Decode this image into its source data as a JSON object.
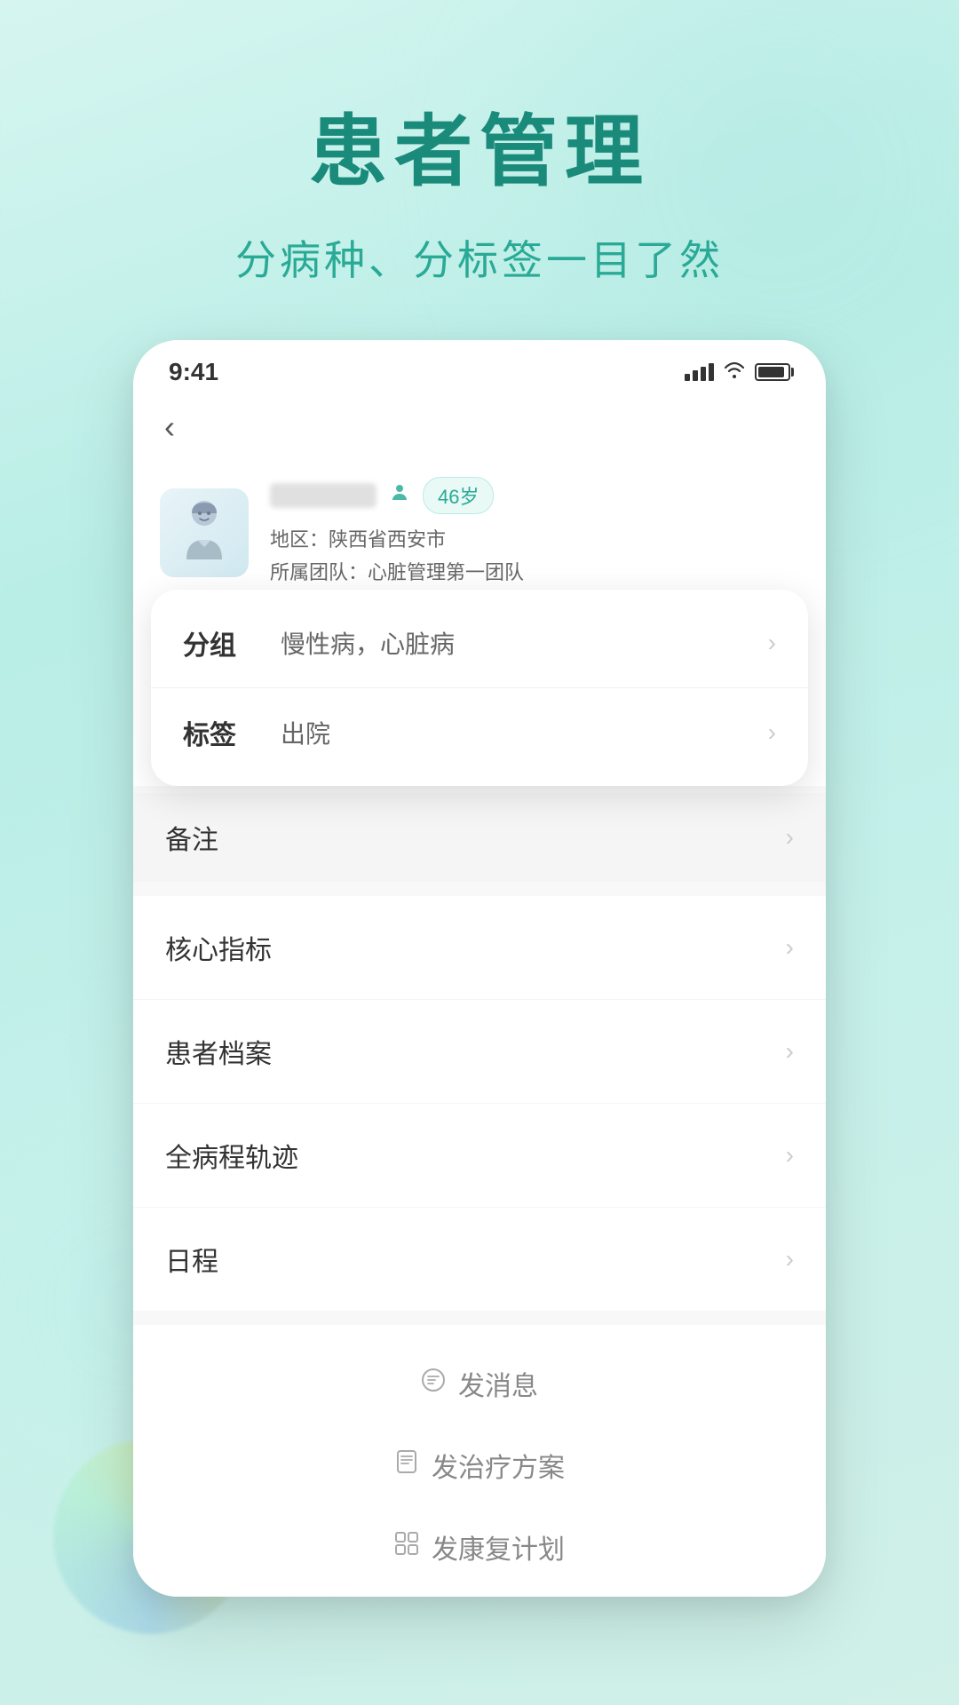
{
  "background": {
    "gradient_start": "#d6f5f0",
    "gradient_end": "#d0f0e8"
  },
  "header": {
    "main_title": "患者管理",
    "sub_title": "分病种、分标签一目了然"
  },
  "status_bar": {
    "time": "9:41",
    "alt": "status icons"
  },
  "nav": {
    "back_label": "‹"
  },
  "patient": {
    "name_placeholder": "患者姓名",
    "age_badge": "46岁",
    "region_label": "地区：",
    "region_value": "陕西省西安市",
    "team_label": "所属团队：",
    "team_value": "心脏管理第一团队"
  },
  "overlay_card": {
    "group": {
      "label": "分组",
      "value": "慢性病，心脏病"
    },
    "tag": {
      "label": "标签",
      "value": "出院"
    }
  },
  "menu_items": [
    {
      "label": "备注",
      "id": "notes"
    },
    {
      "label": "核心指标",
      "id": "core-indicators"
    },
    {
      "label": "患者档案",
      "id": "patient-file"
    },
    {
      "label": "全病程轨迹",
      "id": "full-track"
    },
    {
      "label": "日程",
      "id": "schedule"
    }
  ],
  "bottom_actions": [
    {
      "label": "发消息",
      "icon": "💬",
      "id": "send-message"
    },
    {
      "label": "发治疗方案",
      "icon": "📋",
      "id": "send-plan"
    },
    {
      "label": "发康复计划",
      "icon": "🔲",
      "id": "send-rehab"
    }
  ],
  "chevron": "›"
}
